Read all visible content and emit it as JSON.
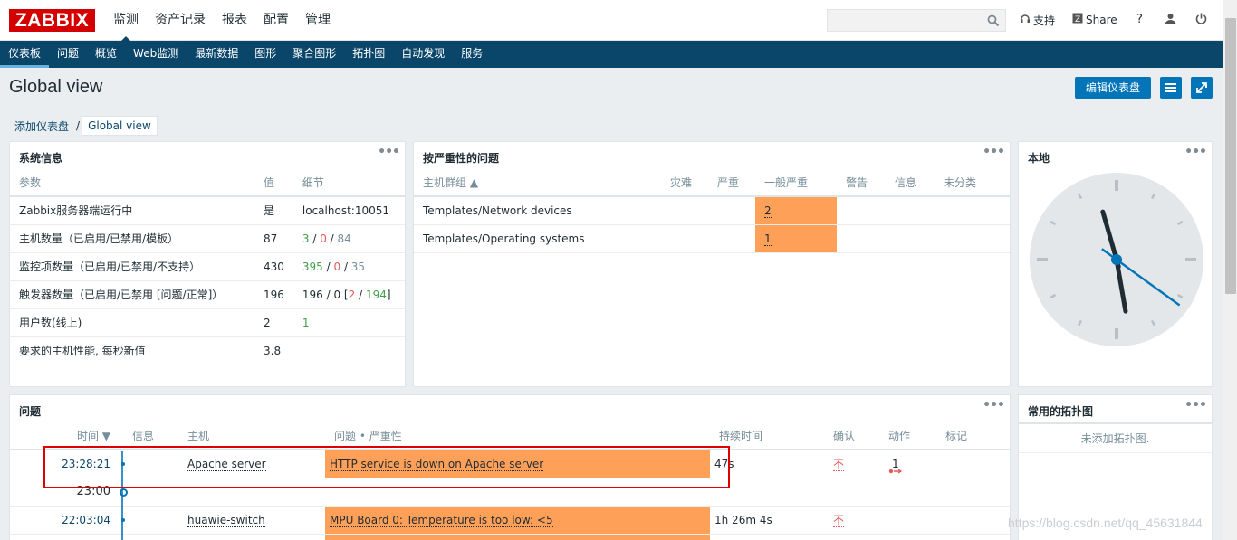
{
  "logo": "ZABBIX",
  "top_menu": [
    "监测",
    "资产记录",
    "报表",
    "配置",
    "管理"
  ],
  "top_links": {
    "support": "支持",
    "share": "Share",
    "help": "?"
  },
  "search": {
    "value": "",
    "placeholder": ""
  },
  "sub_menu": [
    "仪表板",
    "问题",
    "概览",
    "Web监测",
    "最新数据",
    "图形",
    "聚合图形",
    "拓扑图",
    "自动发现",
    "服务"
  ],
  "page": {
    "title": "Global view",
    "edit_button": "编辑仪表盘"
  },
  "breadcrumb": {
    "parent": "添加仪表盘",
    "separator": "/",
    "current": "Global view"
  },
  "sysinfo": {
    "title": "系统信息",
    "columns": [
      "参数",
      "值",
      "细节"
    ],
    "rows": [
      {
        "param": "Zabbix服务器端运行中",
        "value": "是",
        "d": [
          "localhost:10051",
          "",
          "",
          "",
          "",
          "",
          "",
          ""
        ]
      },
      {
        "param": "主机数量（已启用/已禁用/模板）",
        "value": "87",
        "d": [
          "3",
          " / ",
          "0",
          " / ",
          "84",
          "",
          "",
          ""
        ]
      },
      {
        "param": "监控项数量（已启用/已禁用/不支持）",
        "value": "430",
        "d": [
          "395",
          " / ",
          "0",
          " / ",
          "35",
          "",
          "",
          ""
        ]
      },
      {
        "param": "触发器数量（已启用/已禁用 [问题/正常]）",
        "value": "196",
        "d": [
          "196 / 0 [",
          "2",
          " / ",
          "194",
          "]",
          "",
          "",
          ""
        ]
      },
      {
        "param": "用户数(线上)",
        "value": "2",
        "d": [
          "1",
          "",
          "",
          "",
          "",
          "",
          "",
          ""
        ]
      },
      {
        "param": "要求的主机性能, 每秒新值",
        "value": "3.8",
        "d": [
          "",
          "",
          "",
          "",
          "",
          "",
          "",
          ""
        ]
      }
    ]
  },
  "severity": {
    "title": "按严重性的问题",
    "columns": [
      "主机群组 ▲",
      "灾难",
      "严重",
      "一般严重",
      "警告",
      "信息",
      "未分类"
    ],
    "rows": [
      {
        "group": "Templates/Network devices",
        "average": "2"
      },
      {
        "group": "Templates/Operating systems",
        "average": "1"
      }
    ]
  },
  "clock": {
    "title": "本地",
    "time": "23:28:21"
  },
  "problems": {
    "title": "问题",
    "columns": [
      "时间 ▼",
      "信息",
      "主机",
      "问题 • 严重性",
      "持续时间",
      "确认",
      "动作",
      "标记"
    ],
    "rows": [
      {
        "time": "23:28:21",
        "host": "Apache server",
        "problem": "HTTP service is down on Apache server",
        "duration": "47s",
        "ack": "不",
        "actions": "1"
      },
      {
        "time": "22:03:04",
        "host": "huawie-switch",
        "problem": "MPU Board 0: Temperature is too low: <5",
        "duration": "1h 26m 4s",
        "ack": "不",
        "actions": ""
      }
    ],
    "hour_marker": "23:00"
  },
  "maps": {
    "title": "常用的拓扑图",
    "empty": "未添加拓扑图."
  },
  "watermark": "https://blog.csdn.net/qq_45631844",
  "colors": {
    "brand": "#d40000",
    "nav": "#0a466a",
    "average": "#ffa059",
    "button": "#0275b8"
  }
}
